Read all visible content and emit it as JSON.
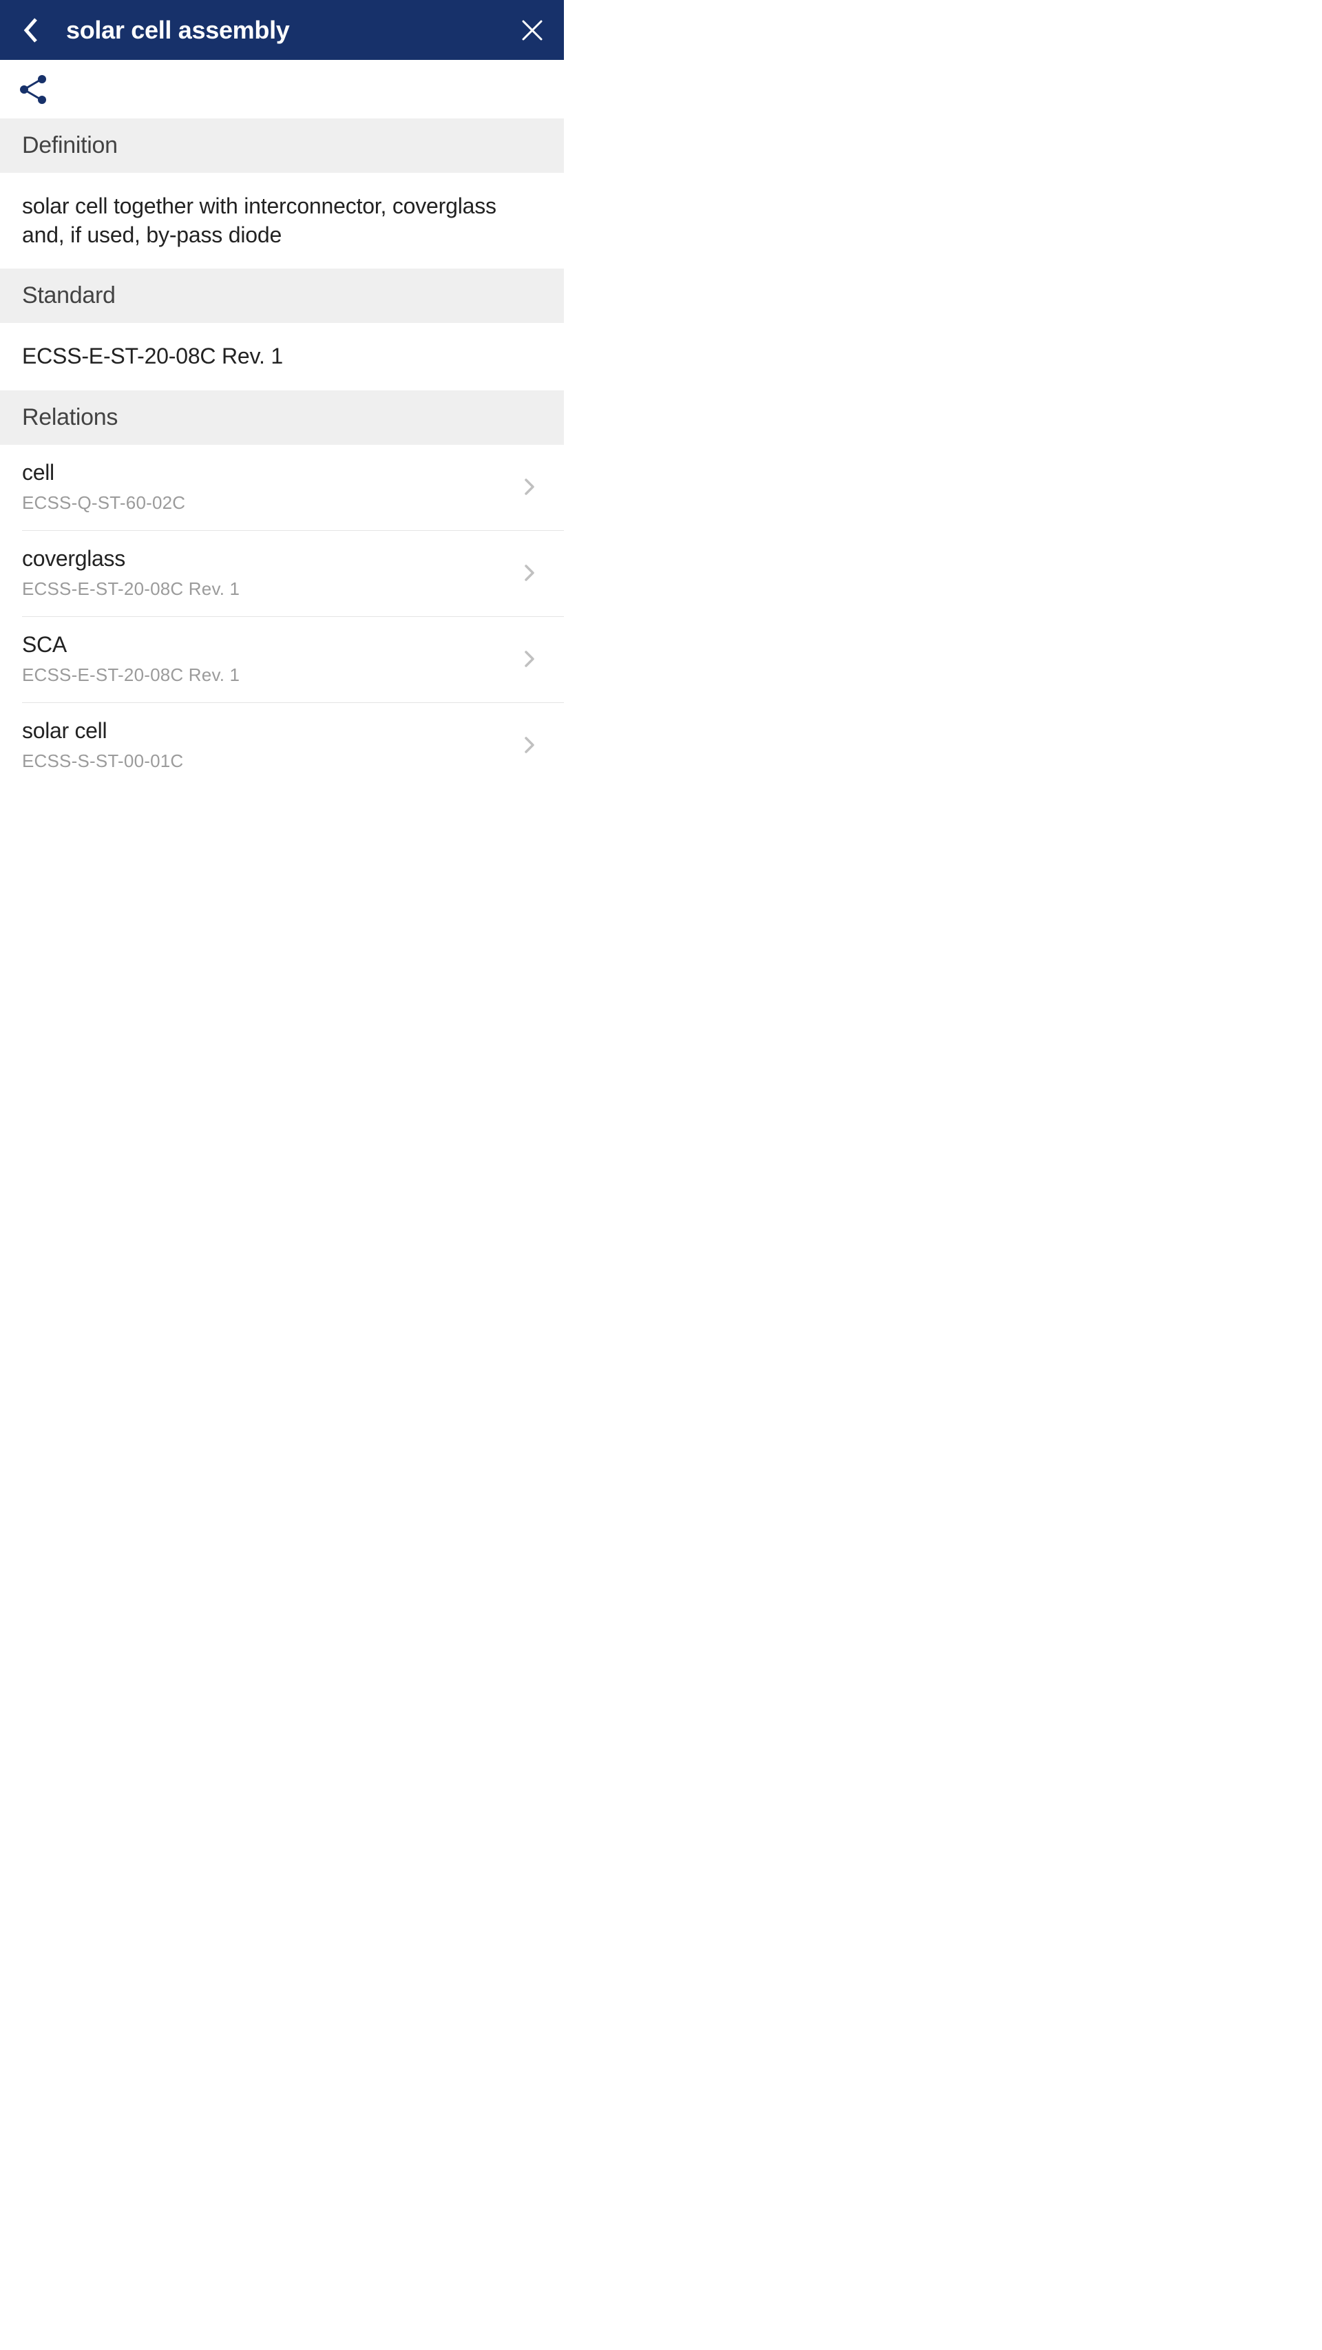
{
  "header": {
    "title": "solar cell assembly"
  },
  "sections": {
    "definition": {
      "label": "Definition",
      "content": "solar cell together with interconnector, coverglass and, if used, by-pass diode"
    },
    "standard": {
      "label": "Standard",
      "content": "ECSS-E-ST-20-08C Rev. 1"
    },
    "relations": {
      "label": "Relations",
      "items": [
        {
          "title": "cell",
          "subtitle": "ECSS-Q-ST-60-02C"
        },
        {
          "title": "coverglass",
          "subtitle": "ECSS-E-ST-20-08C Rev. 1"
        },
        {
          "title": "SCA",
          "subtitle": "ECSS-E-ST-20-08C Rev. 1"
        },
        {
          "title": "solar cell",
          "subtitle": "ECSS-S-ST-00-01C"
        }
      ]
    }
  }
}
